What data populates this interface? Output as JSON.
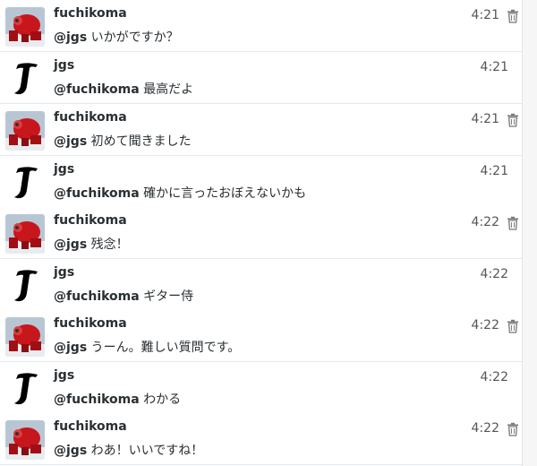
{
  "tweets": [
    {
      "user": "fuchikoma",
      "time": "4:21",
      "mention": "@jgs",
      "body": "いかがですか？",
      "deletable": true
    },
    {
      "user": "jgs",
      "time": "4:21",
      "mention": "@fuchikoma",
      "body": "最高だよ",
      "deletable": false
    },
    {
      "user": "fuchikoma",
      "time": "4:21",
      "mention": "@jgs",
      "body": "初めて聞きました",
      "deletable": true
    },
    {
      "user": "jgs",
      "time": "4:21",
      "mention": "@fuchikoma",
      "body": "確かに言ったおぼえないかも",
      "deletable": false
    },
    {
      "user": "fuchikoma",
      "time": "4:22",
      "mention": "@jgs",
      "body": "残念！",
      "deletable": true
    },
    {
      "user": "jgs",
      "time": "4:22",
      "mention": "@fuchikoma",
      "body": "ギター侍",
      "deletable": false
    },
    {
      "user": "fuchikoma",
      "time": "4:22",
      "mention": "@jgs",
      "body": "うーん。難しい質問です。",
      "deletable": true
    },
    {
      "user": "jgs",
      "time": "4:22",
      "mention": "@fuchikoma",
      "body": "わかる",
      "deletable": false
    },
    {
      "user": "fuchikoma",
      "time": "4:22",
      "mention": "@jgs",
      "body": "わあ！いいですね！",
      "deletable": true
    }
  ],
  "colors": {
    "text": "#292f33",
    "divider": "#e1e8ed",
    "time": "#555555"
  }
}
